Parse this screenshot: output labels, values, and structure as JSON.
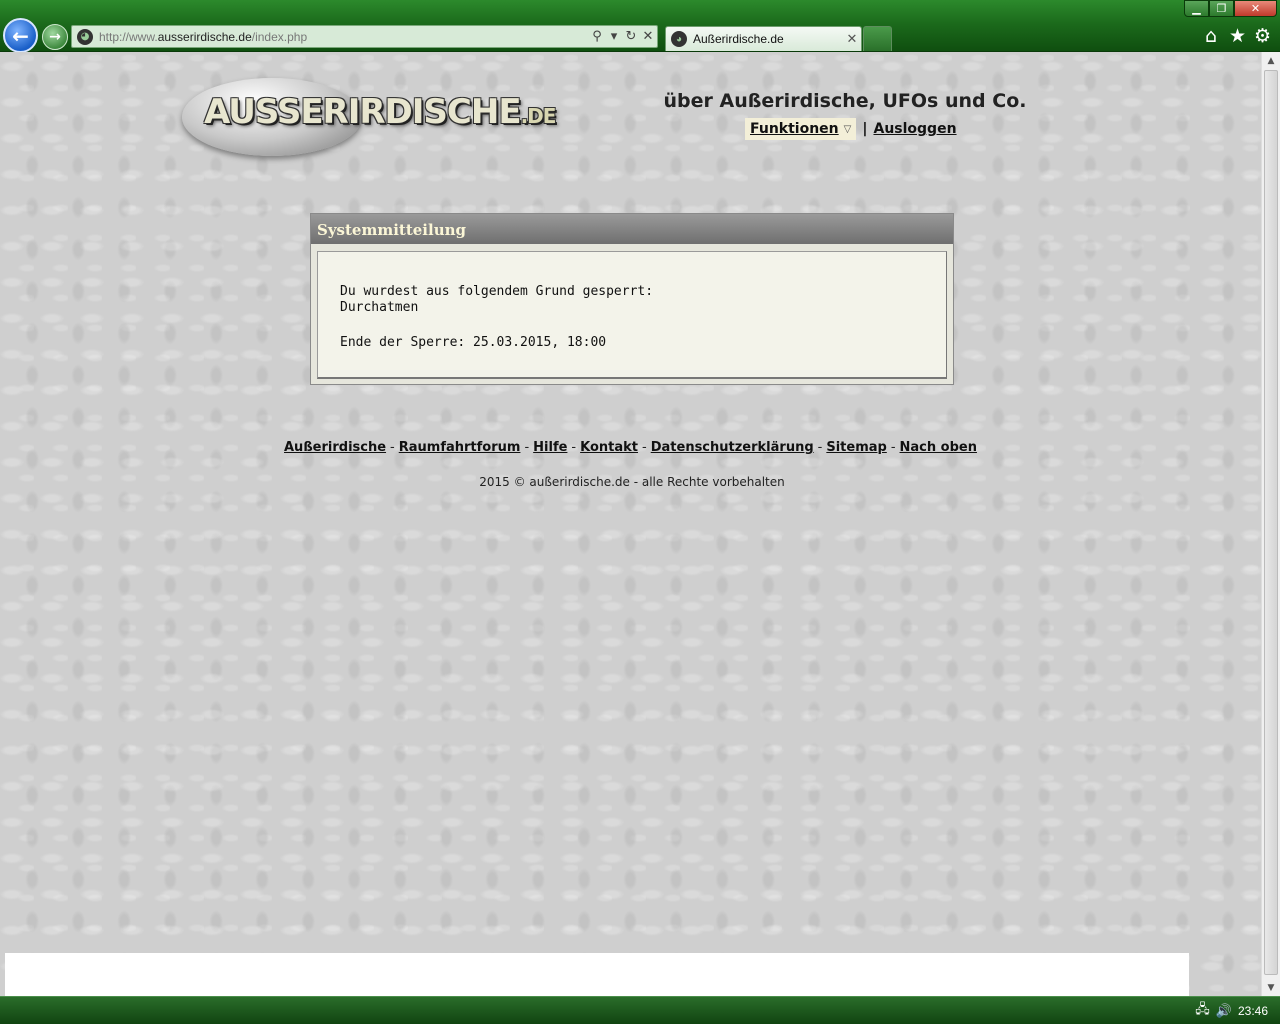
{
  "browser": {
    "url_prefix": "http://www.",
    "url_domain": "ausserirdische.de",
    "url_path": "/index.php",
    "tab_title": "Außerirdische.de",
    "tab_close": "✕",
    "icons": [
      "back-arrow-icon",
      "forward-arrow-icon",
      "search-icon",
      "refresh-icon",
      "stop-icon",
      "home-icon",
      "star-icon",
      "gear-icon"
    ]
  },
  "header": {
    "logo_main": "AUSSERIRDISCHE",
    "logo_suffix": ".DE",
    "tagline": "über Außerirdische, UFOs und Co.",
    "functions_label": "Funktionen",
    "separator": "|",
    "logout_label": "Ausloggen"
  },
  "notice": {
    "title": "Systemmitteilung",
    "line1": "Du wurdest aus folgendem Grund gesperrt:",
    "reason": "Durchatmen",
    "ban_end": "Ende der Sperre: 25.03.2015, 18:00"
  },
  "footer": {
    "links": [
      "Außerirdische",
      "Raumfahrtforum",
      "Hilfe",
      "Kontakt",
      "Datenschutzerklärung",
      "Sitemap",
      "Nach oben"
    ],
    "separator": "-",
    "copyright": "2015 © außerirdische.de - alle Rechte vorbehalten"
  },
  "taskbar": {
    "clock": "23:46"
  }
}
